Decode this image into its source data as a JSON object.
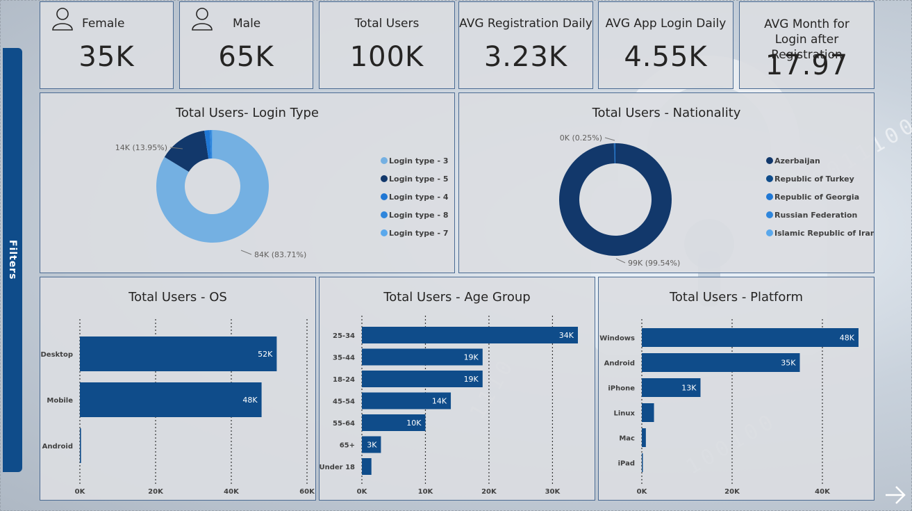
{
  "kpis": [
    {
      "label": "Female",
      "value": "35K",
      "icon": "female-user-icon"
    },
    {
      "label": "Male",
      "value": "65K",
      "icon": "male-user-icon"
    },
    {
      "label": "Total Users",
      "value": "100K"
    },
    {
      "label": "AVG Registration Daily",
      "value": "3.23K"
    },
    {
      "label": "AVG App Login Daily",
      "value": "4.55K"
    },
    {
      "label": "AVG Month for Login after Registration",
      "value": "17.97"
    }
  ],
  "filters_label": "Filters",
  "colors": {
    "dark_blue": "#0f4c8a",
    "navy": "#12386b",
    "light_blue": "#74b0e2",
    "mid_blue": "#1f77d4",
    "bright_blue": "#3a8fe0"
  },
  "chart_data": [
    {
      "type": "pie",
      "title": "Total Users- Login Type",
      "slices": [
        {
          "name": "Login type - 3",
          "value": 84,
          "percent": 83.71,
          "label": "84K (83.71%)",
          "color": "#74b0e2"
        },
        {
          "name": "Login type - 5",
          "value": 14,
          "percent": 13.95,
          "label": "14K (13.95%)",
          "color": "#12386b"
        },
        {
          "name": "Login type - 4",
          "value": 1.5,
          "percent": 1.5,
          "color": "#1f77d4"
        },
        {
          "name": "Login type - 8",
          "value": 0.6,
          "percent": 0.6,
          "color": "#2f86dc"
        },
        {
          "name": "Login type - 7",
          "value": 0.24,
          "percent": 0.24,
          "color": "#5aa8ec"
        }
      ],
      "legend": [
        "Login type - 3",
        "Login type - 5",
        "Login type - 4",
        "Login type - 8",
        "Login type - 7"
      ],
      "legend_position": "right"
    },
    {
      "type": "pie",
      "title": "Total Users - Nationality",
      "slices": [
        {
          "name": "Azerbaijan",
          "value": 99,
          "percent": 99.54,
          "label": "99K (99.54%)",
          "color": "#12386b"
        },
        {
          "name": "Republic of Turkey",
          "value": 0.2,
          "percent": 0.21,
          "color": "#0f4c8a"
        },
        {
          "name": "Republic of Georgia",
          "value": 0.25,
          "percent": 0.25,
          "label": "0K (0.25%)",
          "color": "#1f77d4"
        },
        {
          "name": "Russian Federation",
          "value": 0.0,
          "percent": 0.0,
          "color": "#2f86dc"
        },
        {
          "name": "Islamic Republic of Iran",
          "value": 0.0,
          "percent": 0.0,
          "color": "#5aa8ec"
        }
      ],
      "legend": [
        "Azerbaijan",
        "Republic of Turkey",
        "Republic of Georgia",
        "Russian Federation",
        "Islamic Republic of Iran"
      ],
      "legend_position": "right"
    },
    {
      "type": "bar",
      "orientation": "horizontal",
      "title": "Total Users - OS",
      "categories": [
        "Desktop",
        "Mobile",
        "Android"
      ],
      "values": [
        52,
        48,
        0.3
      ],
      "value_labels": [
        "52K",
        "48K",
        ""
      ],
      "xlim": [
        0,
        60
      ],
      "ticks": [
        "0K",
        "20K",
        "40K",
        "60K"
      ],
      "tick_values": [
        0,
        20,
        40,
        60
      ]
    },
    {
      "type": "bar",
      "orientation": "horizontal",
      "title": "Total Users - Age Group",
      "categories": [
        "25-34",
        "35-44",
        "18-24",
        "45-54",
        "55-64",
        "65+",
        "Under 18"
      ],
      "values": [
        34,
        19,
        19,
        14,
        10,
        3,
        1.5
      ],
      "value_labels": [
        "34K",
        "19K",
        "19K",
        "14K",
        "10K",
        "3K",
        ""
      ],
      "xlim": [
        0,
        34
      ],
      "ticks": [
        "0K",
        "10K",
        "20K",
        "30K"
      ],
      "tick_values": [
        0,
        10,
        20,
        30
      ]
    },
    {
      "type": "bar",
      "orientation": "horizontal",
      "title": "Total Users - Platform",
      "categories": [
        "Windows",
        "Android",
        "iPhone",
        "Linux",
        "Mac",
        "iPad"
      ],
      "values": [
        48,
        35,
        13,
        2.7,
        0.9,
        0.2
      ],
      "value_labels": [
        "48K",
        "35K",
        "13K",
        "",
        "",
        ""
      ],
      "xlim": [
        0,
        48
      ],
      "ticks": [
        "0K",
        "20K",
        "40K"
      ],
      "tick_values": [
        0,
        20,
        40
      ]
    }
  ]
}
